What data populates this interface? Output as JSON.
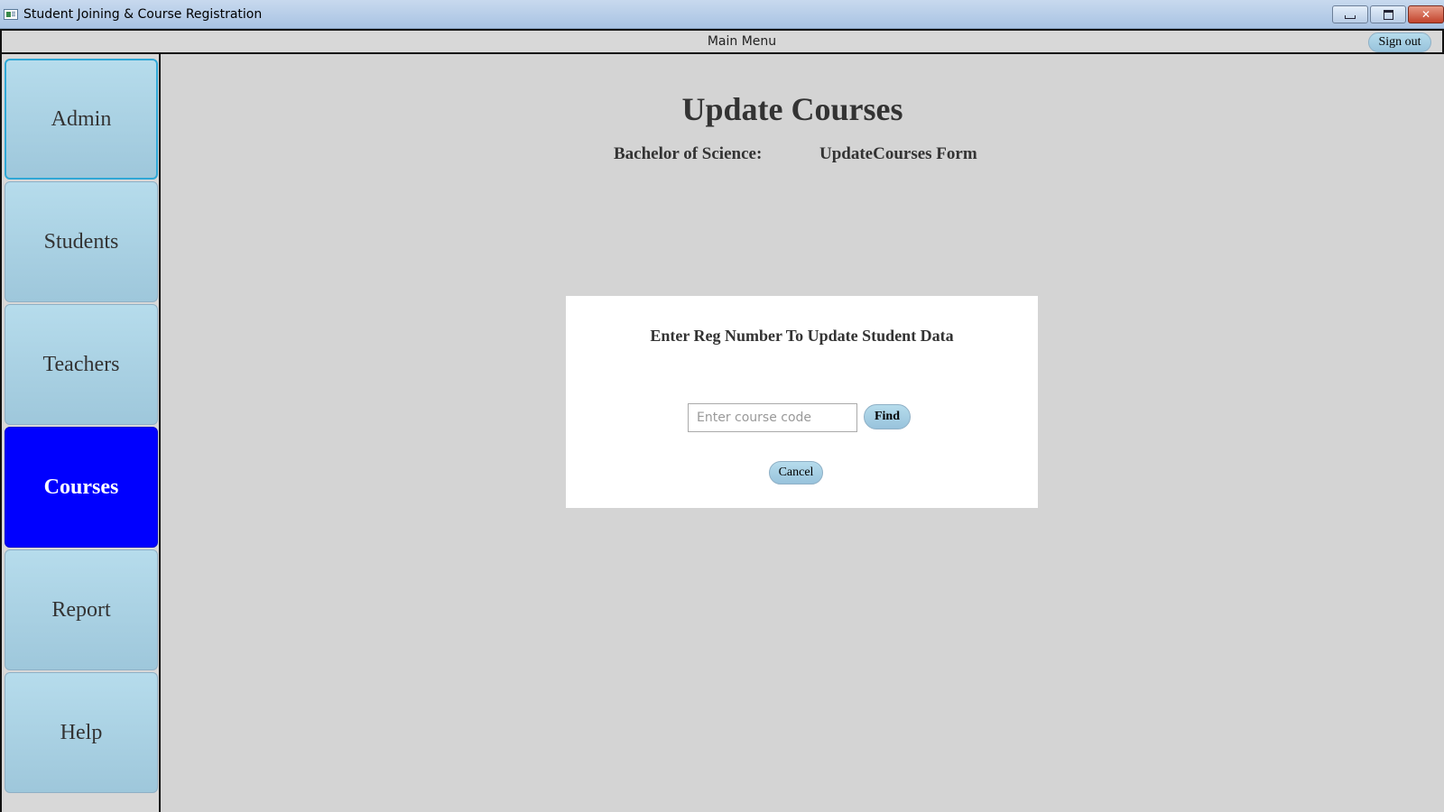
{
  "window": {
    "title": "Student Joining & Course Registration",
    "minimize_icon": "minimize-icon",
    "maximize_icon": "maximize-icon",
    "close_icon": "close-icon",
    "close_glyph": "✕",
    "close_color": "#c2432c"
  },
  "menubar": {
    "title": "Main Menu",
    "sign_out_label": "Sign out"
  },
  "sidebar": {
    "items": [
      {
        "label": "Admin"
      },
      {
        "label": "Students"
      },
      {
        "label": "Teachers"
      },
      {
        "label": "Courses",
        "active": true
      },
      {
        "label": "Report"
      },
      {
        "label": "Help"
      }
    ],
    "active_color": "#0000ff"
  },
  "main": {
    "title": "Update Courses",
    "subtitle_left": "Bachelor of Science:",
    "subtitle_right": "UpdateCourses Form"
  },
  "panel": {
    "heading": "Enter Reg Number To Update Student Data",
    "input_placeholder": "Enter course code",
    "input_value": "",
    "find_label": "Find",
    "cancel_label": "Cancel"
  }
}
